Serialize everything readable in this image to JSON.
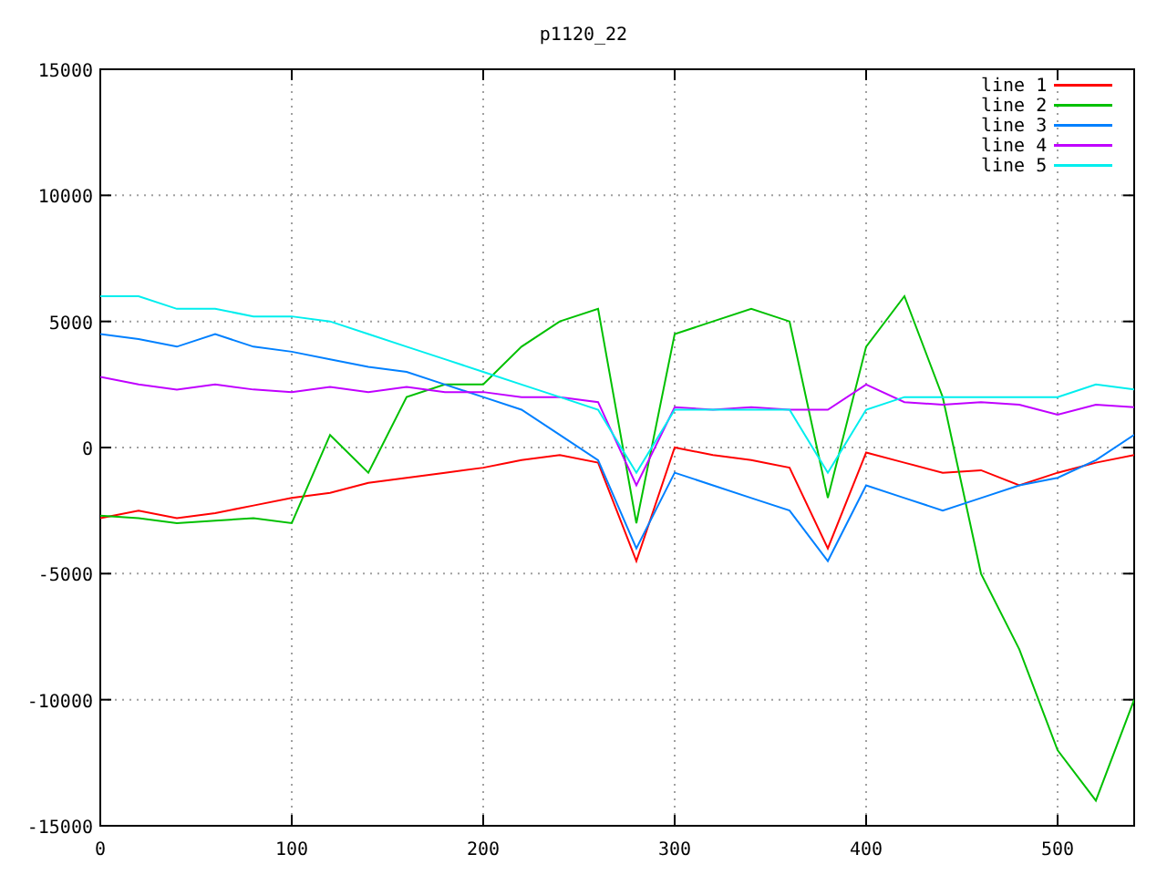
{
  "chart_data": {
    "type": "line",
    "title": "p1120_22",
    "x": [
      0,
      20,
      40,
      60,
      80,
      100,
      120,
      140,
      160,
      180,
      200,
      220,
      240,
      260,
      280,
      300,
      320,
      340,
      360,
      380,
      400,
      420,
      440,
      460,
      480,
      500,
      520,
      540
    ],
    "series": [
      {
        "name": "line 1",
        "color": "#ff0000",
        "values": [
          -2800,
          -2500,
          -2800,
          -2600,
          -2300,
          -2000,
          -1800,
          -1400,
          -1200,
          -1000,
          -800,
          -500,
          -300,
          -600,
          -4500,
          0,
          -300,
          -500,
          -800,
          -4000,
          -200,
          -600,
          -1000,
          -900,
          -1500,
          -1000,
          -600,
          -300
        ]
      },
      {
        "name": "line 2",
        "color": "#00c000",
        "values": [
          -2700,
          -2800,
          -3000,
          -2900,
          -2800,
          -3000,
          500,
          -1000,
          2000,
          2500,
          2500,
          4000,
          5000,
          5500,
          -3000,
          4500,
          5000,
          5500,
          5000,
          -2000,
          4000,
          6000,
          2000,
          -5000,
          -8000,
          -12000,
          -14000,
          -10000
        ]
      },
      {
        "name": "line 3",
        "color": "#0080ff",
        "values": [
          4500,
          4300,
          4000,
          4500,
          4000,
          3800,
          3500,
          3200,
          3000,
          2500,
          2000,
          1500,
          500,
          -500,
          -4000,
          -1000,
          -1500,
          -2000,
          -2500,
          -4500,
          -1500,
          -2000,
          -2500,
          -2000,
          -1500,
          -1200,
          -500,
          500
        ]
      },
      {
        "name": "line 4",
        "color": "#c000ff",
        "values": [
          2800,
          2500,
          2300,
          2500,
          2300,
          2200,
          2400,
          2200,
          2400,
          2200,
          2200,
          2000,
          2000,
          1800,
          -1500,
          1600,
          1500,
          1600,
          1500,
          1500,
          2500,
          1800,
          1700,
          1800,
          1700,
          1300,
          1700,
          1600
        ]
      },
      {
        "name": "line 5",
        "color": "#00eeee",
        "values": [
          6000,
          6000,
          5500,
          5500,
          5200,
          5200,
          5000,
          4500,
          4000,
          3500,
          3000,
          2500,
          2000,
          1500,
          -1000,
          1500,
          1500,
          1500,
          1500,
          -1000,
          1500,
          2000,
          2000,
          2000,
          2000,
          2000,
          2500,
          2300
        ]
      }
    ],
    "xlim": [
      0,
      540
    ],
    "ylim": [
      -15000,
      15000
    ],
    "xticks": [
      0,
      100,
      200,
      300,
      400,
      500
    ],
    "yticks": [
      -15000,
      -10000,
      -5000,
      0,
      5000,
      10000,
      15000
    ],
    "grid": true,
    "legend": true
  }
}
